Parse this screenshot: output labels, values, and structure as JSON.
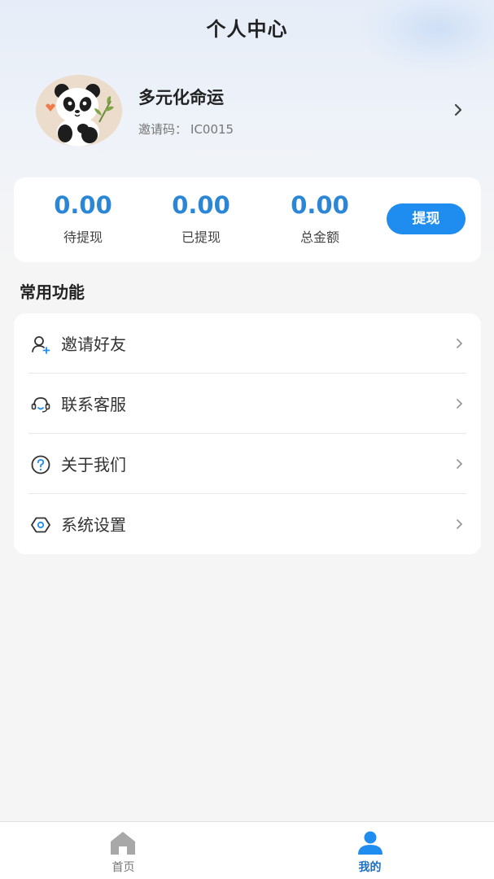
{
  "header": {
    "title": "个人中心"
  },
  "profile": {
    "name": "多元化命运",
    "invite_label": "邀请码：",
    "invite_code": "IC0015",
    "avatar_icon": "panda-avatar",
    "arrow_icon": "chevron-right-icon"
  },
  "balance": {
    "items": [
      {
        "value": "0.00",
        "label": "待提现"
      },
      {
        "value": "0.00",
        "label": "已提现"
      },
      {
        "value": "0.00",
        "label": "总金额"
      }
    ],
    "withdraw_label": "提现",
    "accent_color": "#2c86d6",
    "button_color": "#1f8cf0"
  },
  "functions": {
    "title": "常用功能",
    "items": [
      {
        "label": "邀请好友",
        "icon": "add-user-icon"
      },
      {
        "label": "联系客服",
        "icon": "headset-icon"
      },
      {
        "label": "关于我们",
        "icon": "question-circle-icon"
      },
      {
        "label": "系统设置",
        "icon": "settings-hexagon-icon"
      }
    ]
  },
  "tabbar": {
    "items": [
      {
        "label": "首页",
        "icon": "home-icon",
        "active": false
      },
      {
        "label": "我的",
        "icon": "user-icon",
        "active": true
      }
    ],
    "active_color": "#1f8cf0",
    "inactive_color": "#a8a8a8"
  }
}
